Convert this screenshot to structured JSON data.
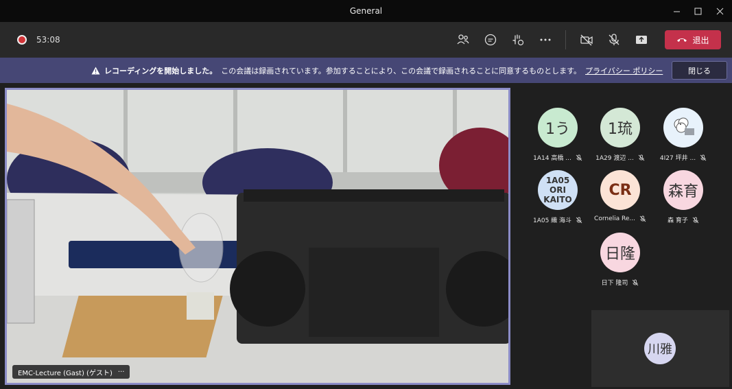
{
  "window": {
    "title": "General"
  },
  "toolbar": {
    "timer": "53:08",
    "leave_label": "退出"
  },
  "banner": {
    "bold_text": "レコーディングを開始しました。",
    "text": "この会議は録画されています。参加することにより、この会議で録画されることに同意するものとします。",
    "link_text": "プライバシー ポリシー",
    "close_label": "閉じる"
  },
  "video": {
    "label": "EMC-Lecture (Gast) (ゲスト)",
    "more": "···"
  },
  "participants": [
    {
      "initials": "1う",
      "name": "1A14 高橋 ...",
      "bg": "#c8ead0"
    },
    {
      "initials": "1琉",
      "name": "1A29 渡辺 ...",
      "bg": "#d4e8d6"
    },
    {
      "initials": "",
      "name": "4I27 坪井 ...",
      "bg": "#e8f2fb"
    },
    {
      "initials_lines": [
        "1A05",
        "ORI",
        "KAITO"
      ],
      "name": "1A05 織 海斗",
      "bg": "#cfe0f5"
    },
    {
      "initials": "CR",
      "name": "Cornelia Re...",
      "bg": "#fbe3d6"
    },
    {
      "initials": "森育",
      "name": "森 育子",
      "bg": "#f8d7e0"
    },
    {
      "initials": "日隆",
      "name": "日下 隆司",
      "bg": "#f8d7e0"
    }
  ],
  "self": {
    "initials": "川雅"
  },
  "colors": {
    "accent": "#8b8cc7",
    "leave": "#c4314b",
    "banner": "#464775"
  }
}
